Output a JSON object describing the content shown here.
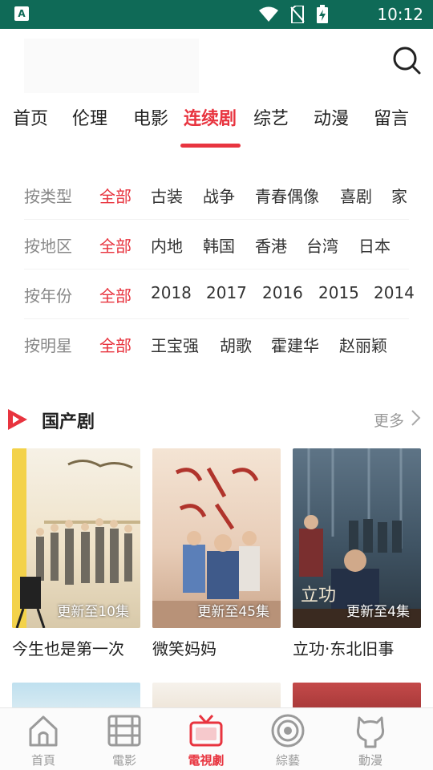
{
  "status_bar": {
    "app_badge": "A",
    "time": "10:12"
  },
  "header": {},
  "tabs": [
    {
      "label": "首页",
      "active": false
    },
    {
      "label": "伦理",
      "active": false
    },
    {
      "label": "电影",
      "active": false
    },
    {
      "label": "连续剧",
      "active": true
    },
    {
      "label": "综艺",
      "active": false
    },
    {
      "label": "动漫",
      "active": false
    },
    {
      "label": "留言",
      "active": false
    }
  ],
  "filters": [
    {
      "label": "按类型",
      "options": [
        "全部",
        "古装",
        "战争",
        "青春偶像",
        "喜剧",
        "家"
      ],
      "selected": 0
    },
    {
      "label": "按地区",
      "options": [
        "全部",
        "内地",
        "韩国",
        "香港",
        "台湾",
        "日本"
      ],
      "selected": 0
    },
    {
      "label": "按年份",
      "options": [
        "全部",
        "2018",
        "2017",
        "2016",
        "2015",
        "2014"
      ],
      "selected": 0
    },
    {
      "label": "按明星",
      "options": [
        "全部",
        "王宝强",
        "胡歌",
        "霍建华",
        "赵丽颖"
      ],
      "selected": 0
    }
  ],
  "section": {
    "title": "国产剧",
    "more": "更多"
  },
  "cards": [
    {
      "title": "今生也是第一次",
      "badge": "更新至10集"
    },
    {
      "title": "微笑妈妈",
      "badge": "更新至45集"
    },
    {
      "title": "立功·东北旧事",
      "badge": "更新至4集"
    }
  ],
  "bottom_nav": [
    {
      "label": "首頁",
      "icon": "home-icon",
      "active": false
    },
    {
      "label": "電影",
      "icon": "film-icon",
      "active": false
    },
    {
      "label": "電視劇",
      "icon": "tv-icon",
      "active": true
    },
    {
      "label": "綜藝",
      "icon": "target-icon",
      "active": false
    },
    {
      "label": "動漫",
      "icon": "cat-icon",
      "active": false
    }
  ],
  "colors": {
    "accent": "#e8343f",
    "status_bar": "#0f6a57"
  }
}
